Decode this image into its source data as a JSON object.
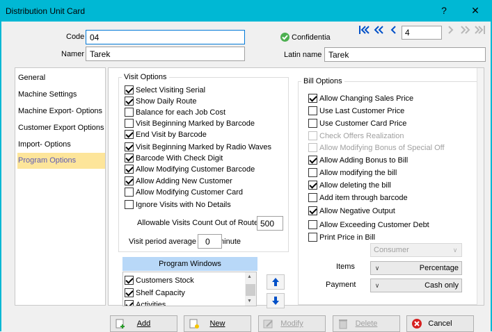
{
  "window": {
    "title": "Distribution Unit Card",
    "help": "?",
    "close": "✕"
  },
  "header": {
    "code_label": "Code",
    "code_value": "04",
    "name_label": "Namer",
    "name_value": "Tarek",
    "confidential_label": "Confidentia",
    "latin_label": "Latin name",
    "latin_value": "Tarek",
    "nav": {
      "first": "|«",
      "prev_fast": "«",
      "prev": "<",
      "record": "4",
      "next": ">",
      "next_fast": "»",
      "last": "»|"
    }
  },
  "sidebar": {
    "items": [
      {
        "label": "General"
      },
      {
        "label": "Machine Settings"
      },
      {
        "label": "Machine Export- Options"
      },
      {
        "label": "Customer Export Options"
      },
      {
        "label": "Import- Options"
      },
      {
        "label": "Program Options"
      }
    ]
  },
  "visit_options": {
    "title": "Visit Options",
    "items": [
      {
        "label": "Select Visiting Serial",
        "checked": true
      },
      {
        "label": "Show Daily Route",
        "checked": true
      },
      {
        "label": "Balance for each Job Cost",
        "checked": false
      },
      {
        "label": "Visit Beginning Marked by Barcode",
        "checked": false
      },
      {
        "label": "End Visit by Barcode",
        "checked": true
      },
      {
        "label": "Visit Beginning Marked by Radio Waves",
        "checked": true
      },
      {
        "label": "Barcode With Check Digit",
        "checked": true
      },
      {
        "label": "Allow Modifying Customer Barcode",
        "checked": true
      },
      {
        "label": "Allow Adding New Customer",
        "checked": true
      },
      {
        "label": "Allow Modifying Customer Card",
        "checked": false
      },
      {
        "label": "Ignore Visits with No Details",
        "checked": false
      }
    ],
    "allowable_label": "Allowable Visits Count Out of Route",
    "allowable_value": "500",
    "period_label": "Visit period average",
    "period_value": "0",
    "period_unit": "minute"
  },
  "program_windows": {
    "title": "Program Windows",
    "items": [
      {
        "label": "Customers Stock",
        "checked": true
      },
      {
        "label": "Shelf Capacity",
        "checked": true
      },
      {
        "label": "Activities",
        "checked": true
      }
    ],
    "up": "▲",
    "down": "▼"
  },
  "bill_options": {
    "title": "Bill Options",
    "items": [
      {
        "label": "Allow Changing Sales Price",
        "checked": true,
        "disabled": false
      },
      {
        "label": "Use Last Customer Price",
        "checked": false,
        "disabled": false
      },
      {
        "label": "Use Customer Card Price",
        "checked": false,
        "disabled": false
      },
      {
        "label": "Check Offers Realization",
        "checked": false,
        "disabled": true
      },
      {
        "label": "Allow Modifying Bonus of Special Off",
        "checked": false,
        "disabled": true
      },
      {
        "label": "Allow Adding Bonus to Bill",
        "checked": true,
        "disabled": false
      },
      {
        "label": "Allow modifying the bill",
        "checked": false,
        "disabled": false
      },
      {
        "label": "Allow deleting the bill",
        "checked": true,
        "disabled": false
      },
      {
        "label": "Add item through barcode",
        "checked": false,
        "disabled": false
      },
      {
        "label": "Allow Negative Output",
        "checked": true,
        "disabled": false
      },
      {
        "label": "Allow Exceeding Customer Debt",
        "checked": false,
        "disabled": false
      },
      {
        "label": "Print Price in Bill",
        "checked": false,
        "disabled": false
      }
    ],
    "price_combo": "Consumer",
    "items_label": "Items",
    "items_combo": "Percentage",
    "payment_label": "Payment",
    "payment_combo": "Cash only"
  },
  "footer": {
    "add": "Add",
    "new": "New",
    "modify": "Modify",
    "delete": "Delete",
    "cancel": "Cancel"
  },
  "colors": {
    "titlebar": "#00b8d4",
    "selected_nav": "#fde59a",
    "accent": "#0050c8"
  }
}
